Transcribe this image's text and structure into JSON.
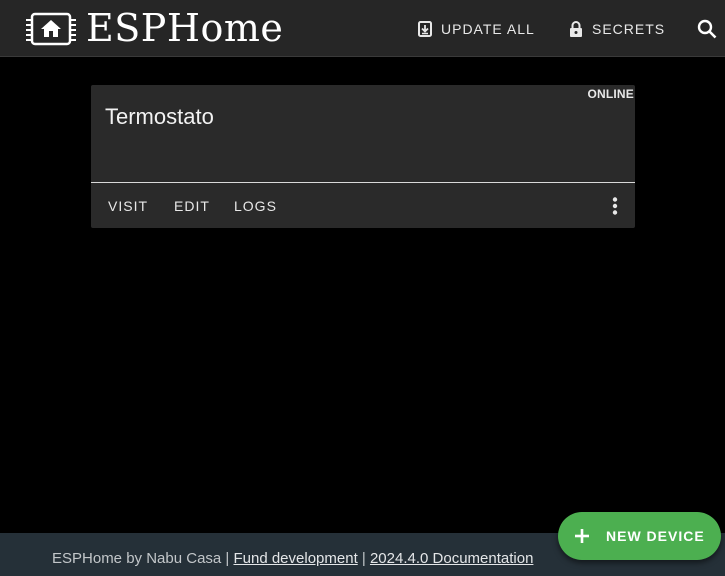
{
  "header": {
    "brand": "ESPHome",
    "update_all_label": "UPDATE ALL",
    "secrets_label": "SECRETS",
    "icons": [
      "esphome-logo",
      "update-icon",
      "lock-icon",
      "search-icon"
    ]
  },
  "devices": [
    {
      "name": "Termostato",
      "status": "ONLINE",
      "actions": [
        "VISIT",
        "EDIT",
        "LOGS"
      ],
      "menu_icon": "more-vert-icon"
    }
  ],
  "footer": {
    "prefix": "ESPHome by Nabu Casa | ",
    "fund_link": "Fund development",
    "separator": " | ",
    "docs_link": "2024.4.0 Documentation"
  },
  "fab": {
    "label": "NEW DEVICE",
    "icon": "plus-icon"
  },
  "colors": {
    "background": "#000000",
    "header": "#262626",
    "card": "#2a2a2a",
    "footer": "#253038",
    "fab": "#4caf50"
  }
}
